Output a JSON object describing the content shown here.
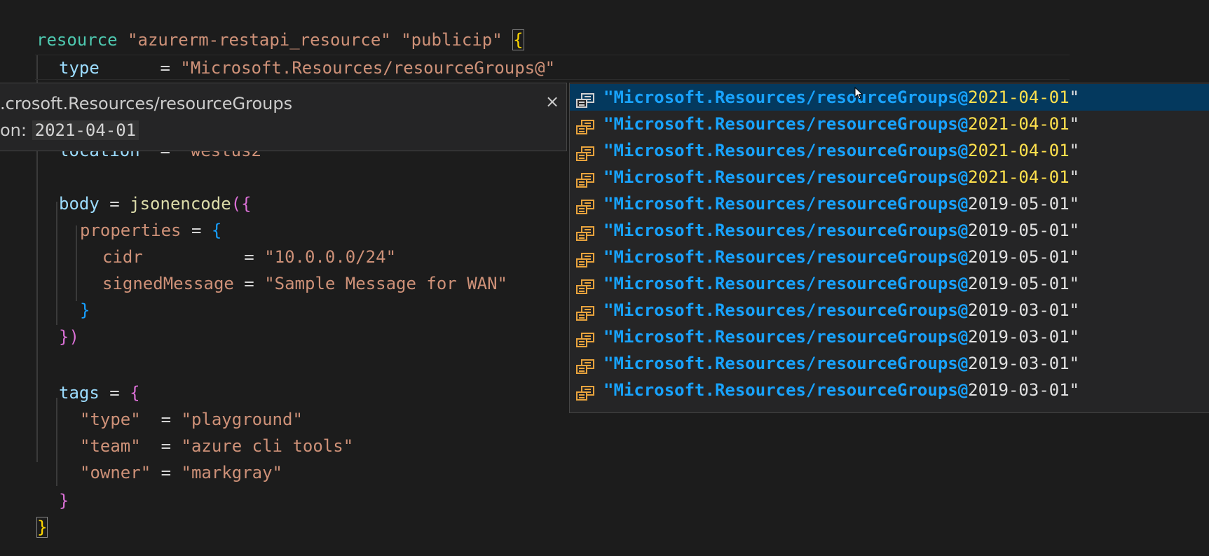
{
  "code": {
    "line1": {
      "kw": "resource",
      "s1": "\"azurerm-restapi_resource\"",
      "s2": "\"publicip\"",
      "brace": "{"
    },
    "line2": {
      "key": "type",
      "eq": "      = ",
      "val": "\"Microsoft.Resources/resourceGroups@\""
    },
    "line4": {
      "key": "location",
      "eq": "  = ",
      "val": "\"westus2\""
    },
    "line6": {
      "key": "body",
      "eq": " = ",
      "fn": "jsonencode",
      "open": "({"
    },
    "line7": {
      "key": "properties",
      "eq": " = ",
      "brace": "{"
    },
    "line8": {
      "key": "cidr",
      "eq": "          = ",
      "val": "\"10.0.0.0/24\""
    },
    "line9": {
      "key": "signedMessage",
      "eq": " = ",
      "val": "\"Sample Message for WAN\""
    },
    "line10": {
      "close": "}"
    },
    "line11": {
      "close": "})"
    },
    "line13": {
      "key": "tags",
      "eq": " = ",
      "brace": "{"
    },
    "line14": {
      "key": "\"type\"",
      "eq": "  = ",
      "val": "\"playground\""
    },
    "line15": {
      "key": "\"team\"",
      "eq": "  = ",
      "val": "\"azure cli tools\""
    },
    "line16": {
      "key": "\"owner\"",
      "eq": " = ",
      "val": "\"markgray\""
    },
    "line17": {
      "close": "}"
    },
    "line18": {
      "close": "}"
    }
  },
  "hover": {
    "title": ".crosoft.Resources/resourceGroups",
    "version_label": "on:",
    "version_value": "2021-04-01",
    "close_glyph": "×"
  },
  "suggestions": [
    {
      "prefix": "\"Microsoft.Resources/resourceGroups@",
      "version": "2021-04-01",
      "suffix": "\""
    },
    {
      "prefix": "\"Microsoft.Resources/resourceGroups@",
      "version": "2021-04-01",
      "suffix": "\""
    },
    {
      "prefix": "\"Microsoft.Resources/resourceGroups@",
      "version": "2021-04-01",
      "suffix": "\""
    },
    {
      "prefix": "\"Microsoft.Resources/resourceGroups@",
      "version": "2021-04-01",
      "suffix": "\""
    },
    {
      "prefix": "\"Microsoft.Resources/resourceGroups@",
      "version": "2019-05-01",
      "suffix": "\""
    },
    {
      "prefix": "\"Microsoft.Resources/resourceGroups@",
      "version": "2019-05-01",
      "suffix": "\""
    },
    {
      "prefix": "\"Microsoft.Resources/resourceGroups@",
      "version": "2019-05-01",
      "suffix": "\""
    },
    {
      "prefix": "\"Microsoft.Resources/resourceGroups@",
      "version": "2019-05-01",
      "suffix": "\""
    },
    {
      "prefix": "\"Microsoft.Resources/resourceGroups@",
      "version": "2019-03-01",
      "suffix": "\""
    },
    {
      "prefix": "\"Microsoft.Resources/resourceGroups@",
      "version": "2019-03-01",
      "suffix": "\""
    },
    {
      "prefix": "\"Microsoft.Resources/resourceGroups@",
      "version": "2019-03-01",
      "suffix": "\""
    },
    {
      "prefix": "\"Microsoft.Resources/resourceGroups@",
      "version": "2019-03-01",
      "suffix": "\""
    }
  ],
  "icons": {
    "suggestion": "enum-member-icon",
    "close": "close-icon",
    "cursor": "mouse-cursor-icon"
  },
  "colors": {
    "selected_row": "#04395e",
    "suggestion_highlight": "#18a3ff",
    "icon_orange": "#e8a33d",
    "icon_selected": "#d0d0d0"
  }
}
